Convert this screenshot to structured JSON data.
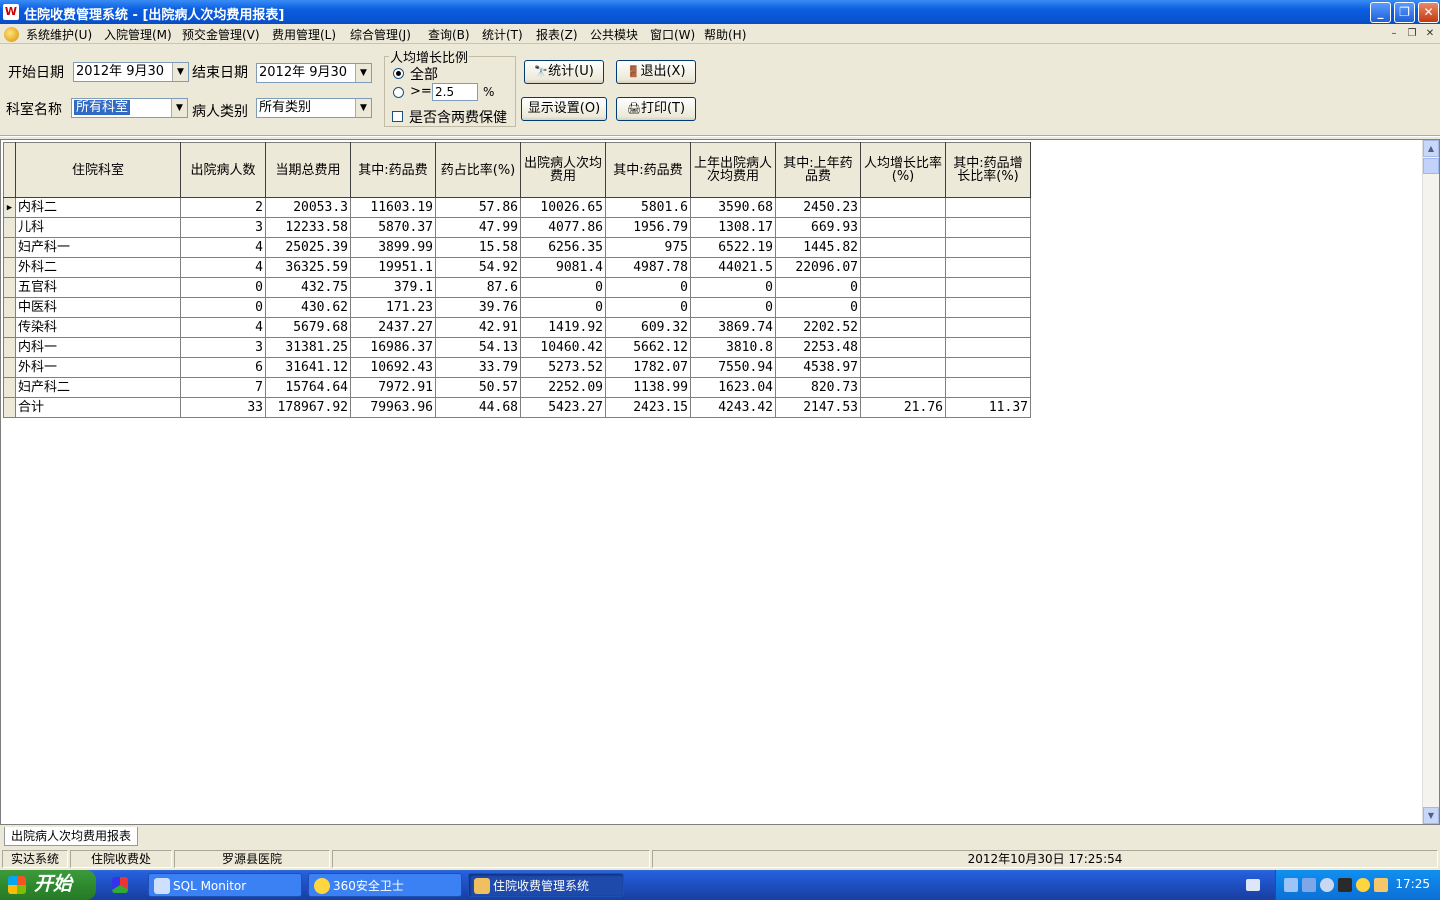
{
  "window": {
    "title": "住院收费管理系统 - [出院病人次均费用报表]",
    "app_icon_letter": "W"
  },
  "menu": {
    "items": [
      "系统维护(U)",
      "入院管理(M)",
      "预交金管理(V)",
      "费用管理(L)",
      "综合管理(J)",
      "查询(B)",
      "统计(T)",
      "报表(Z)",
      "公共模块",
      "窗口(W)",
      "帮助(H)"
    ]
  },
  "filters": {
    "start_label": "开始日期",
    "start_value": "2012年 9月30",
    "end_label": "结束日期",
    "end_value": "2012年 9月30",
    "dept_label": "科室名称",
    "dept_value": "所有科室",
    "type_label": "病人类别",
    "type_value": "所有类别"
  },
  "growth_group": {
    "legend": "人均增长比例",
    "option_all": "全部",
    "option_ge": ">=",
    "ge_value": "2.5",
    "percent_sign": "%",
    "include_label": "是否含两费保健"
  },
  "buttons": {
    "stats": "统计(U)",
    "exit": "退出(X)",
    "display": "显示设置(O)",
    "print": "打印(T)"
  },
  "table": {
    "headers": [
      "住院科室",
      "出院病人数",
      "当期总费用",
      "其中:药品费",
      "药占比率(%)",
      "出院病人次均费用",
      "其中:药品费",
      "上年出院病人次均费用",
      "其中:上年药品费",
      "人均增长比率(%)",
      "其中:药品增长比率(%)"
    ],
    "rows": [
      [
        "内科二",
        "2",
        "20053.3",
        "11603.19",
        "57.86",
        "10026.65",
        "5801.6",
        "3590.68",
        "2450.23",
        "",
        ""
      ],
      [
        "儿科",
        "3",
        "12233.58",
        "5870.37",
        "47.99",
        "4077.86",
        "1956.79",
        "1308.17",
        "669.93",
        "",
        ""
      ],
      [
        "妇产科一",
        "4",
        "25025.39",
        "3899.99",
        "15.58",
        "6256.35",
        "975",
        "6522.19",
        "1445.82",
        "",
        ""
      ],
      [
        "外科二",
        "4",
        "36325.59",
        "19951.1",
        "54.92",
        "9081.4",
        "4987.78",
        "44021.5",
        "22096.07",
        "",
        ""
      ],
      [
        "五官科",
        "0",
        "432.75",
        "379.1",
        "87.6",
        "0",
        "0",
        "0",
        "0",
        "",
        ""
      ],
      [
        "中医科",
        "0",
        "430.62",
        "171.23",
        "39.76",
        "0",
        "0",
        "0",
        "0",
        "",
        ""
      ],
      [
        "传染科",
        "4",
        "5679.68",
        "2437.27",
        "42.91",
        "1419.92",
        "609.32",
        "3869.74",
        "2202.52",
        "",
        ""
      ],
      [
        "内科一",
        "3",
        "31381.25",
        "16986.37",
        "54.13",
        "10460.42",
        "5662.12",
        "3810.8",
        "2253.48",
        "",
        ""
      ],
      [
        "外科一",
        "6",
        "31641.12",
        "10692.43",
        "33.79",
        "5273.52",
        "1782.07",
        "7550.94",
        "4538.97",
        "",
        ""
      ],
      [
        "妇产科二",
        "7",
        "15764.64",
        "7972.91",
        "50.57",
        "2252.09",
        "1138.99",
        "1623.04",
        "820.73",
        "",
        ""
      ],
      [
        "合计",
        "33",
        "178967.92",
        "79963.96",
        "44.68",
        "5423.27",
        "2423.15",
        "4243.42",
        "2147.53",
        "21.76",
        "11.37"
      ]
    ]
  },
  "tabs": [
    "出院病人次均费用报表"
  ],
  "status": {
    "system": "实达系统",
    "department": "住院收费处",
    "hospital": "罗源县医院",
    "blank": "",
    "datetime": "2012年10月30日 17:25:54"
  },
  "taskbar": {
    "start": "开始",
    "tasks": [
      "SQL Monitor",
      "360安全卫士",
      "住院收费管理系统"
    ],
    "clock": "17:25"
  }
}
